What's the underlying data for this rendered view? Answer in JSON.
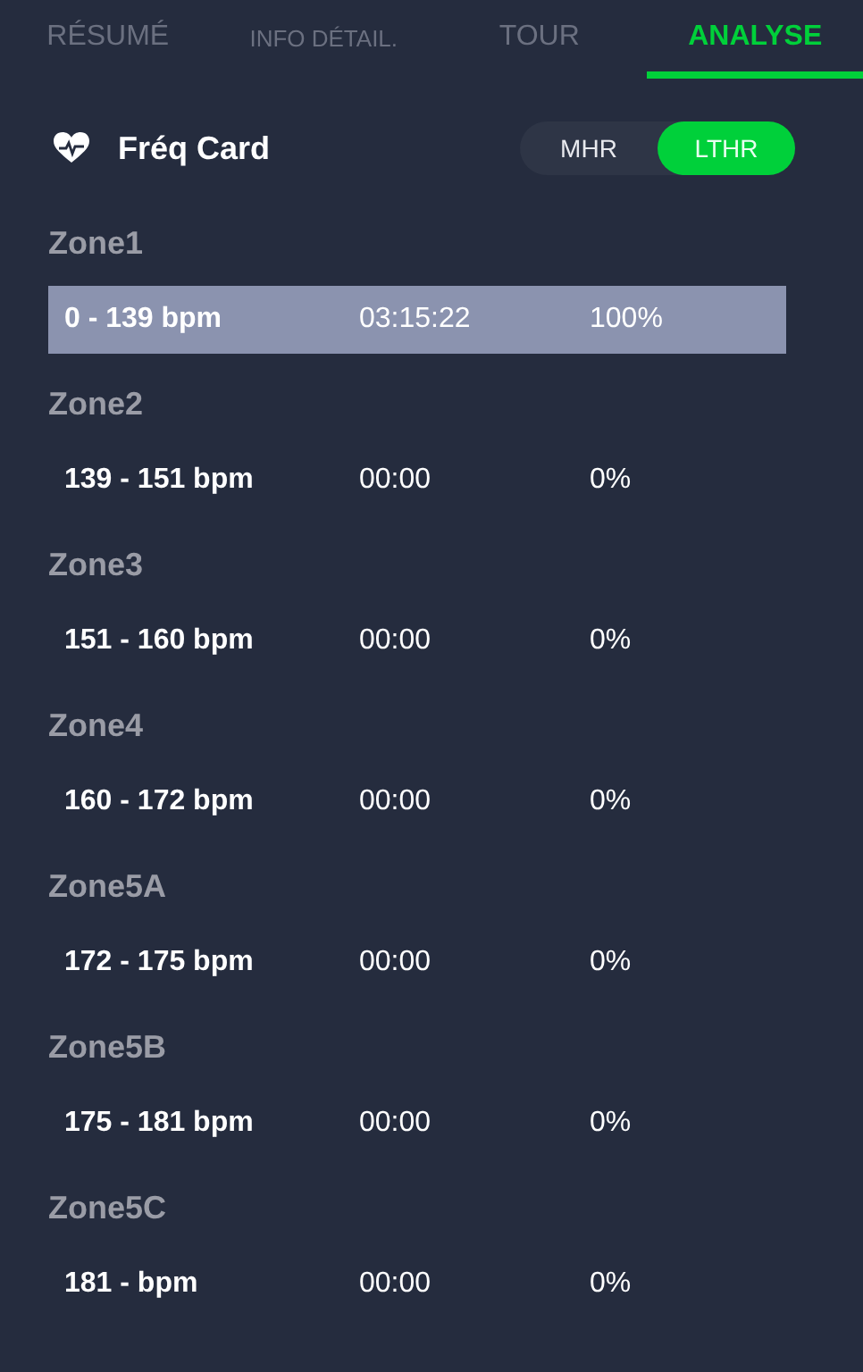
{
  "tabs": [
    {
      "label": "RÉSUMÉ",
      "selected": false
    },
    {
      "label": "INFO DÉTAIL.",
      "selected": false
    },
    {
      "label": "TOUR",
      "selected": false
    },
    {
      "label": "ANALYSE",
      "selected": true
    }
  ],
  "section": {
    "title": "Fréq Card"
  },
  "toggle": [
    {
      "label": "MHR",
      "selected": false
    },
    {
      "label": "LTHR",
      "selected": true
    }
  ],
  "zones": [
    {
      "name": "Zone1",
      "range": "0 - 139 bpm",
      "time": "03:15:22",
      "percent": "100%",
      "highlighted": true
    },
    {
      "name": "Zone2",
      "range": "139 - 151 bpm",
      "time": "00:00",
      "percent": "0%",
      "highlighted": false
    },
    {
      "name": "Zone3",
      "range": "151 - 160 bpm",
      "time": "00:00",
      "percent": "0%",
      "highlighted": false
    },
    {
      "name": "Zone4",
      "range": "160 - 172 bpm",
      "time": "00:00",
      "percent": "0%",
      "highlighted": false
    },
    {
      "name": "Zone5A",
      "range": "172 - 175 bpm",
      "time": "00:00",
      "percent": "0%",
      "highlighted": false
    },
    {
      "name": "Zone5B",
      "range": "175 - 181 bpm",
      "time": "00:00",
      "percent": "0%",
      "highlighted": false
    },
    {
      "name": "Zone5C",
      "range": "181 -  bpm",
      "time": "00:00",
      "percent": "0%",
      "highlighted": false
    }
  ]
}
